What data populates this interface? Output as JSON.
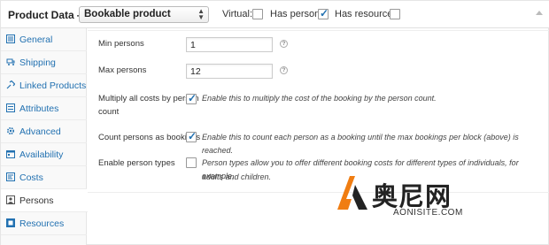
{
  "header": {
    "title": "Product Data —",
    "product_type": "Bookable product",
    "virtual_label": "Virtual:",
    "virtual_checked": false,
    "has_persons_label": "Has persons:",
    "has_persons_checked": true,
    "has_resources_label": "Has resources:",
    "has_resources_checked": false
  },
  "sidebar": {
    "items": [
      {
        "label": "General",
        "icon": "wrench-icon",
        "active": false
      },
      {
        "label": "Shipping",
        "icon": "truck-icon",
        "active": false
      },
      {
        "label": "Linked Products",
        "icon": "link-icon",
        "active": false
      },
      {
        "label": "Attributes",
        "icon": "list-icon",
        "active": false
      },
      {
        "label": "Advanced",
        "icon": "gear-icon",
        "active": false
      },
      {
        "label": "Availability",
        "icon": "calendar-icon",
        "active": false
      },
      {
        "label": "Costs",
        "icon": "tag-icon",
        "active": false
      },
      {
        "label": "Persons",
        "icon": "person-icon",
        "active": true
      },
      {
        "label": "Resources",
        "icon": "box-icon",
        "active": false
      }
    ]
  },
  "fields": {
    "min_persons": {
      "label": "Min persons",
      "value": "1"
    },
    "max_persons": {
      "label": "Max persons",
      "value": "12"
    },
    "multiply": {
      "label_line1": "Multiply all costs by person",
      "label_line2": "count",
      "checked": true,
      "description": "Enable this to multiply the cost of the booking by the person count."
    },
    "count_as_bookings": {
      "label": "Count persons as bookings",
      "checked": true,
      "description": "Enable this to count each person as a booking until the max bookings per block (above) is reached."
    },
    "person_types": {
      "label": "Enable person types",
      "checked": false,
      "description_line1": "Person types allow you to offer different booking costs for different types of individuals, for example,",
      "description_line2": "adults and children."
    }
  },
  "watermark": {
    "text": "奥尼网",
    "sub": "AONISITE.COM"
  },
  "colors": {
    "link": "#2271b1",
    "check": "#2271b1",
    "logo_orange": "#f07d12"
  }
}
